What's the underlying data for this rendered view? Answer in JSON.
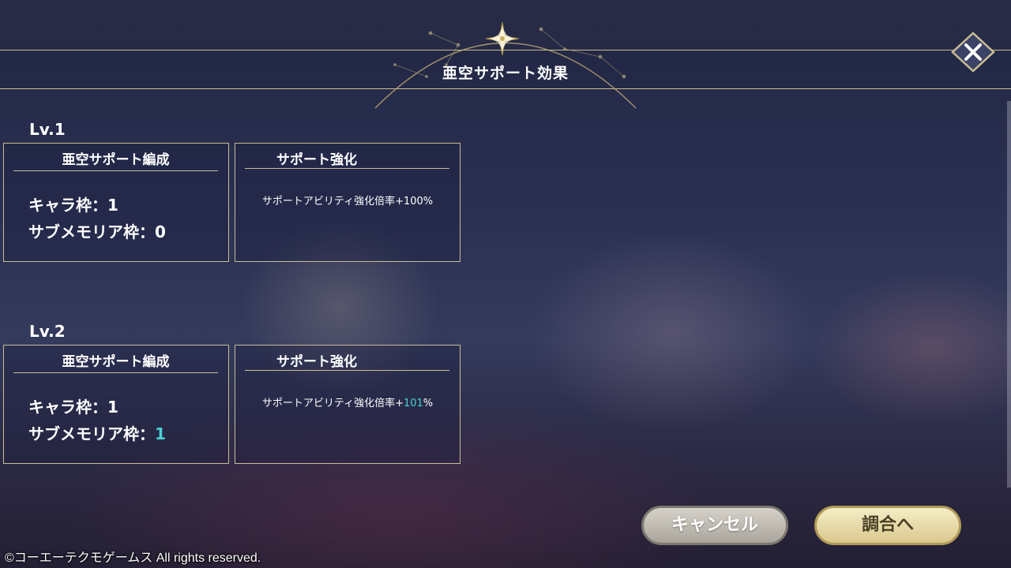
{
  "header": {
    "title": "亜空サポート効果"
  },
  "levels": [
    {
      "label": "Lv.1",
      "formation": {
        "heading": "亜空サポート編成",
        "chara_label": "キャラ枠：",
        "chara_value": "1",
        "memoria_label": "サブメモリア枠：",
        "memoria_value": "0"
      },
      "support": {
        "heading": "サポート強化",
        "text_prefix": "サポートアビリティ強化倍率+",
        "value": "100",
        "suffix": "%"
      }
    },
    {
      "label": "Lv.2",
      "formation": {
        "heading": "亜空サポート編成",
        "chara_label": "キャラ枠：",
        "chara_value": "1",
        "memoria_label": "サブメモリア枠：",
        "memoria_value": "1"
      },
      "support": {
        "heading": "サポート強化",
        "text_prefix": "サポートアビリティ強化倍率+",
        "value": "101",
        "suffix": "%"
      }
    }
  ],
  "buttons": {
    "cancel": "キャンセル",
    "confirm": "調合へ"
  },
  "footer": {
    "copyright": "©コーエーテクモゲームス All rights reserved."
  },
  "colors": {
    "gold_line": "#c9bd94",
    "highlight": "#4ad1d5",
    "bg": "#2a3052"
  },
  "icons": {
    "close": "close-icon",
    "emblem": "star-compass-icon"
  }
}
